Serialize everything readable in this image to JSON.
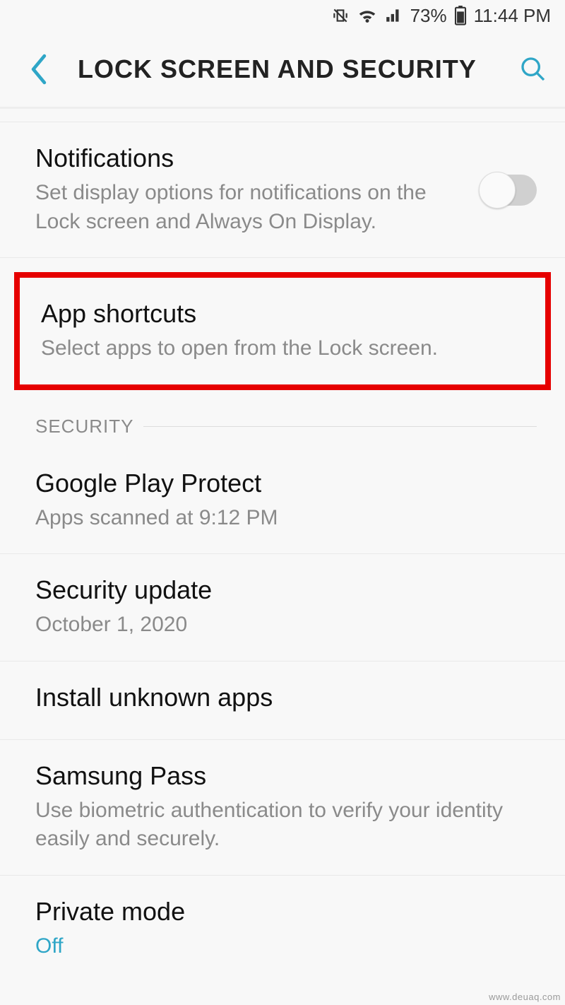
{
  "status_bar": {
    "battery_pct": "73%",
    "time": "11:44 PM"
  },
  "header": {
    "title": "LOCK SCREEN AND SECURITY"
  },
  "items": {
    "notifications": {
      "title": "Notifications",
      "sub": "Set display options for notifications on the Lock screen and Always On Display.",
      "toggle_on": false
    },
    "app_shortcuts": {
      "title": "App shortcuts",
      "sub": "Select apps to open from the Lock screen."
    }
  },
  "section_security": "SECURITY",
  "security_items": {
    "play_protect": {
      "title": "Google Play Protect",
      "sub": "Apps scanned at 9:12 PM"
    },
    "security_update": {
      "title": "Security update",
      "sub": "October 1, 2020"
    },
    "install_unknown": {
      "title": "Install unknown apps"
    },
    "samsung_pass": {
      "title": "Samsung Pass",
      "sub": "Use biometric authentication to verify your identity easily and securely."
    },
    "private_mode": {
      "title": "Private mode",
      "sub": "Off"
    }
  },
  "source_credit": "www.deuaq.com"
}
